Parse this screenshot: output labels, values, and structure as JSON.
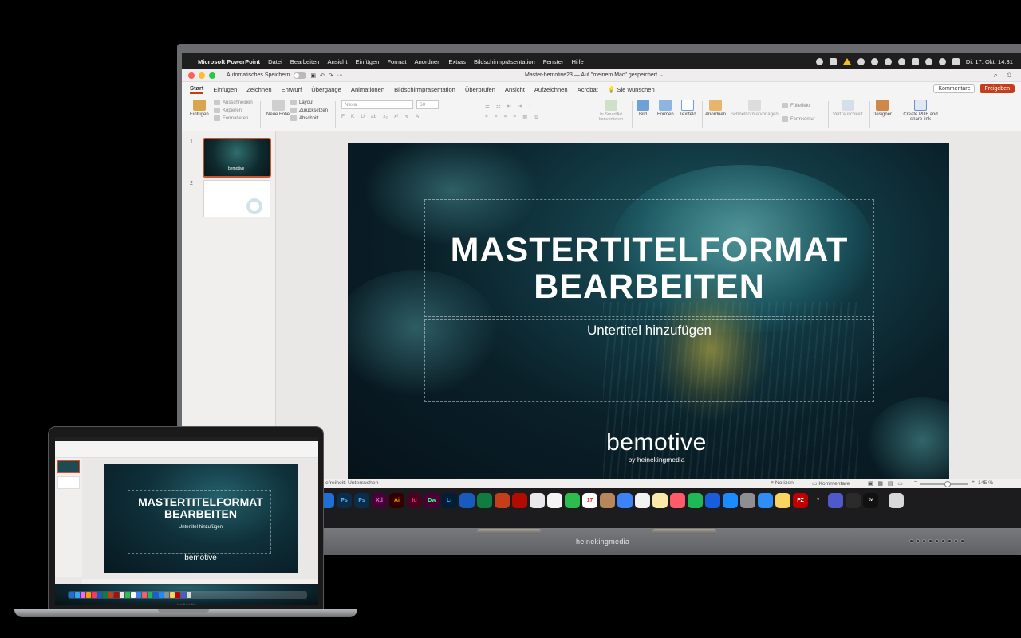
{
  "menubar": {
    "apple": "",
    "app_name": "Microsoft PowerPoint",
    "items": [
      "Datei",
      "Bearbeiten",
      "Ansicht",
      "Einfügen",
      "Format",
      "Anordnen",
      "Extras",
      "Bildschirmpräsentation",
      "Fenster",
      "Hilfe"
    ],
    "clock": "Di. 17. Okt.  14:31"
  },
  "window": {
    "autosave_label": "Automatisches Speichern",
    "doc_title": "Master-bemotive23 — Auf \"meinem Mac\" gespeichert ⌄"
  },
  "ribbon_tabs": [
    "Start",
    "Einfügen",
    "Zeichnen",
    "Entwurf",
    "Übergänge",
    "Animationen",
    "Bildschirmpräsentation",
    "Überprüfen",
    "Ansicht",
    "Aufzeichnen",
    "Acrobat"
  ],
  "tell_me": "Sie wünschen",
  "share": {
    "comments": "Kommentare",
    "share": "Freigeben"
  },
  "ribbon": {
    "paste": "Einfügen",
    "cut": "Ausschneiden",
    "copy": "Kopieren",
    "format": "Formatieren",
    "new_slide": "Neue Folie",
    "layout": "Layout",
    "reset": "Zurücksetzen",
    "section": "Abschnitt",
    "font_name": "Nexa",
    "font_size": "60",
    "smartart": "In SmartArt konvertieren",
    "picture": "Bild",
    "shapes": "Formen",
    "textbox": "Textfeld",
    "arrange": "Anordnen",
    "quick_styles": "Schnellformatvorlagen",
    "fill": "Fülleffekt",
    "outline": "Formkontur",
    "sensitivity": "Vertraulichkeit",
    "designer": "Designer",
    "create_pdf": "Create PDF and share link"
  },
  "thumbnails": {
    "slide1_number": "1",
    "slide2_number": "2",
    "thumb_logo": "bemotive"
  },
  "slide": {
    "title_line1": "MASTERTITELFORMAT",
    "title_line2": "BEARBEITEN",
    "subtitle": "Untertitel hinzufügen",
    "logo": "bemotive",
    "logo_by": "by heinekingmedia"
  },
  "statusbar": {
    "accessibility": "efreiheit: Untersuchen",
    "notes": "Notizen",
    "comments": "Kommentare",
    "zoom": "145 %"
  },
  "dock_icons": [
    "outlook",
    "ps",
    "ps",
    "xd",
    "ai",
    "id",
    "dw",
    "lr",
    "word",
    "excel",
    "powerpoint",
    "acrobat",
    "chrome",
    "photos",
    "facetime",
    "calendar",
    "notes",
    "keynote",
    "reminders",
    "music",
    "spotify",
    "bitwarden",
    "app-store",
    "settings",
    "things",
    "notes-yellow",
    "filezilla",
    "help",
    "teams",
    "activity",
    "tv",
    "trash"
  ],
  "dock_labels": {
    "ps1": "Ps",
    "ps2": "Ps",
    "xd": "Xd",
    "ai": "Ai",
    "id": "Id",
    "dw": "Dw",
    "lr": "Lr",
    "cal": "17",
    "fz": "FZ",
    "help": "?",
    "tv": "tv"
  },
  "display_brand": "heinekingmedia",
  "laptop": {
    "title_line1": "MASTERTITELFORMAT",
    "title_line2": "BEARBEITEN",
    "subtitle": "Untertitel hinzufügen",
    "logo": "bemotive",
    "label": "MacBook Pro"
  },
  "colors": {
    "accent": "#c43e1c",
    "selection": "#d0522c"
  }
}
